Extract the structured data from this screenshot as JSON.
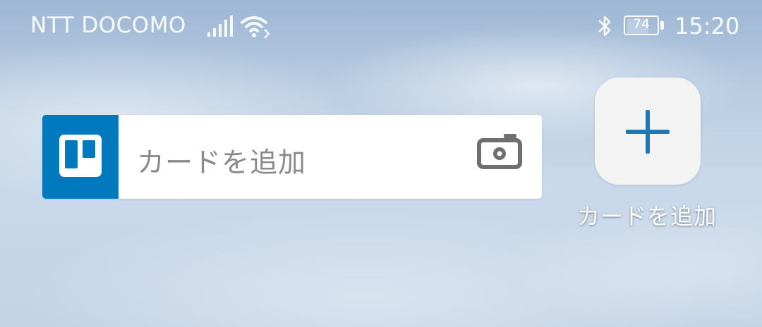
{
  "status_bar": {
    "carrier": "NTT DOCOMO",
    "signal_icon": "signal-bars-icon",
    "wifi_icon": "wifi-icon",
    "bluetooth_icon": "bluetooth-icon",
    "battery_level": "74",
    "battery_fraction": 0.74,
    "time": "15:20"
  },
  "widget": {
    "logo_icon": "trello-logo-icon",
    "input_placeholder": "カードを追加",
    "camera_icon": "camera-icon",
    "brand_color": "#0079bf"
  },
  "shortcut": {
    "icon": "plus-icon",
    "label": "カードを追加",
    "icon_color": "#1f78b4"
  }
}
